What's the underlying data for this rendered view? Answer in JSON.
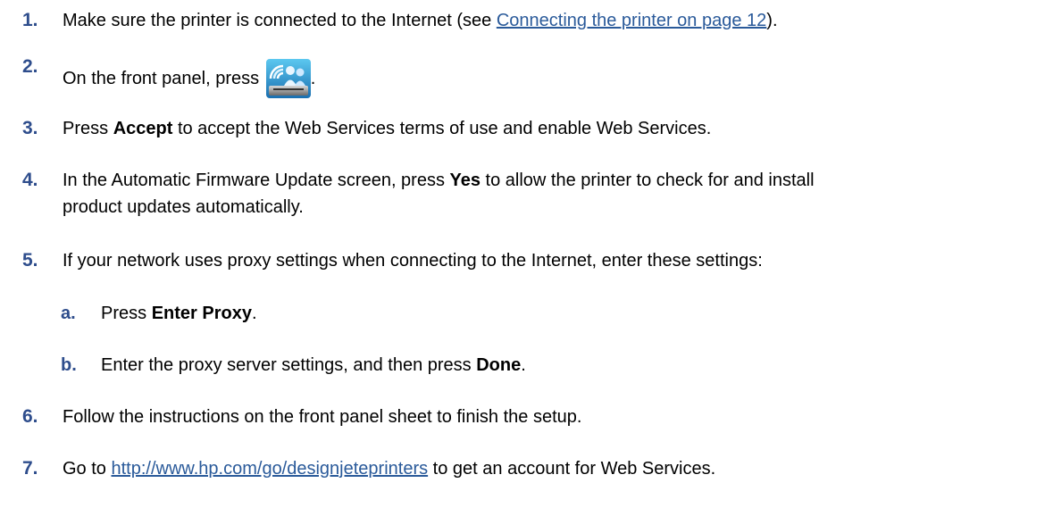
{
  "colors": {
    "step_number": "#2e4d8c",
    "link": "#2a5a9a"
  },
  "steps": [
    {
      "num": "1.",
      "pre": "Make sure the printer is connected to the Internet (see ",
      "link": "Connecting the printer on page 12",
      "post": ")."
    },
    {
      "num": "2.",
      "pre": "On the front panel, press ",
      "icon": "web-services-icon",
      "post": "."
    },
    {
      "num": "3.",
      "pre": "Press ",
      "bold": "Accept",
      "post": " to accept the Web Services terms of use and enable Web Services."
    },
    {
      "num": "4.",
      "pre": "In the Automatic Firmware Update screen, press ",
      "bold": "Yes",
      "post": " to allow the printer to check for and install",
      "line2": "product updates automatically."
    },
    {
      "num": "5.",
      "text": "If your network uses proxy settings when connecting to the Internet, enter these settings:"
    },
    {
      "num": "6.",
      "text": "Follow the instructions on the front panel sheet to finish the setup."
    },
    {
      "num": "7.",
      "pre": "Go to ",
      "link": "http://www.hp.com/go/designjeteprinters",
      "post": " to get an account for Web Services."
    }
  ],
  "substeps": [
    {
      "letter": "a.",
      "pre": "Press ",
      "bold": "Enter Proxy",
      "post": "."
    },
    {
      "letter": "b.",
      "pre": "Enter the proxy server settings, and then press ",
      "bold": "Done",
      "post": "."
    }
  ]
}
